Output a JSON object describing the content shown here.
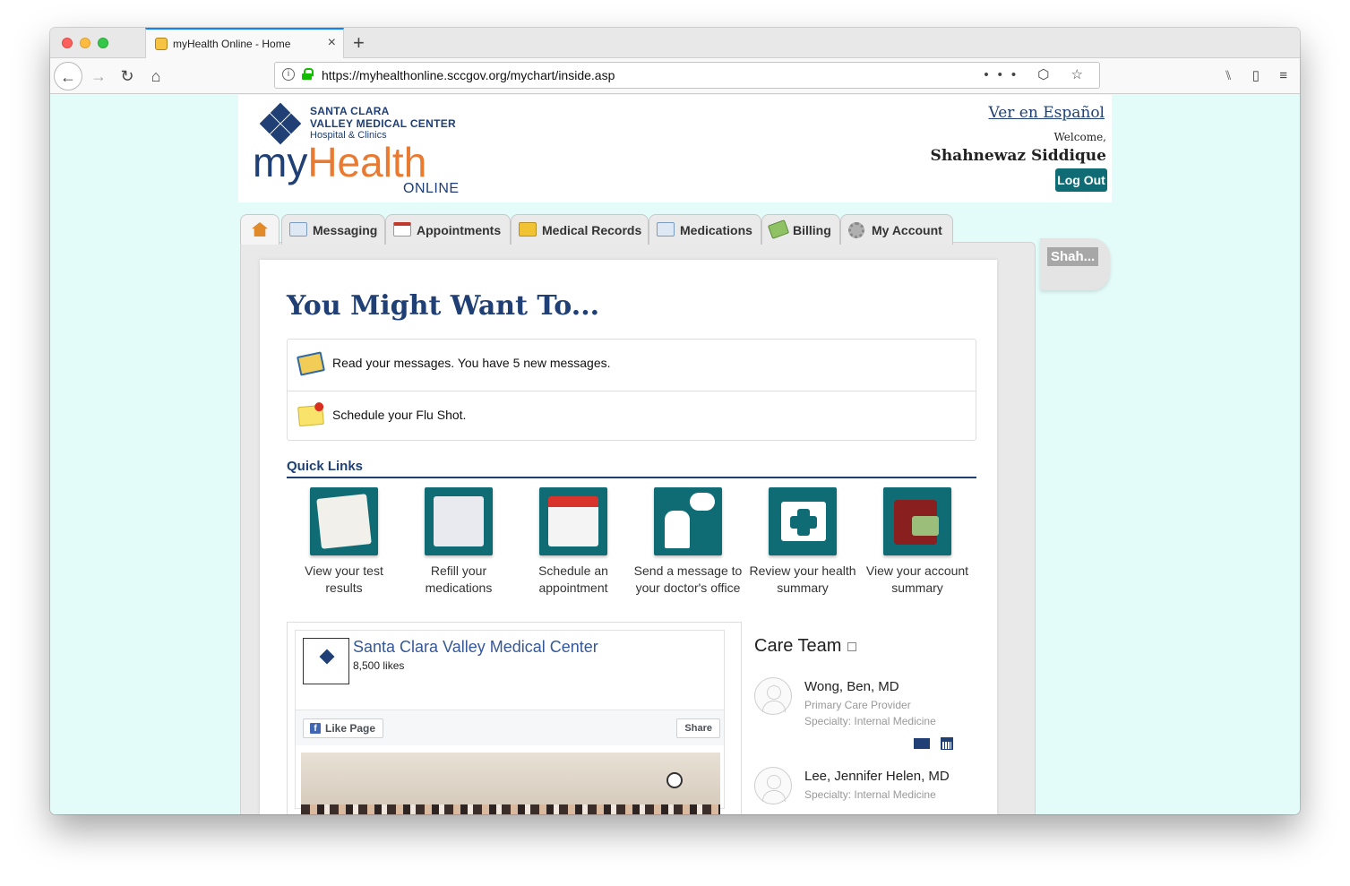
{
  "browser": {
    "tab_title": "myHealth Online - Home",
    "new_tab": "+",
    "close_tab": "×",
    "url_prefix": "https://",
    "url_host": "myhealthonline.sccgov.org",
    "url_path": "/mychart/inside.asp",
    "url_icons": "••• ⬡ ☆",
    "back": "←",
    "forward": "→",
    "reload": "↻",
    "home": "⌂",
    "library": "⑊",
    "sidebar": "▯",
    "menu": "≡"
  },
  "header": {
    "org_line1": "SANTA CLARA",
    "org_line2": "VALLEY MEDICAL CENTER",
    "org_line3": "Hospital & Clinics",
    "brand_my": "my",
    "brand_health": "Health",
    "brand_online": "ONLINE",
    "lang_link": "Ver en Español",
    "welcome": "Welcome,",
    "username": "Shahnewaz Siddique",
    "logout": "Log Out"
  },
  "tabs": [
    {
      "label": "",
      "icon": "home-icon"
    },
    {
      "label": "Messaging",
      "icon": "envelope-icon"
    },
    {
      "label": "Appointments",
      "icon": "calendar-icon"
    },
    {
      "label": "Medical Records",
      "icon": "folder-icon"
    },
    {
      "label": "Medications",
      "icon": "envelope-icon"
    },
    {
      "label": "Billing",
      "icon": "money-icon"
    },
    {
      "label": "My Account",
      "icon": "gear-icon"
    }
  ],
  "proxy_label": "Shah...",
  "main": {
    "title": "You Might Want To...",
    "messages": [
      {
        "text": "Read your messages. You have 5 new messages.",
        "icon": "envelope-icon"
      },
      {
        "text": "Schedule your Flu Shot.",
        "icon": "sticky-note-icon"
      }
    ],
    "quick_links_title": "Quick Links",
    "quick_links": [
      {
        "line1": "View your test",
        "line2": "results",
        "icon": "test-results-icon",
        "color": "#f2f0ea"
      },
      {
        "line1": "Refill your",
        "line2": "medications",
        "icon": "prescription-icon",
        "color": "#e9eaf0"
      },
      {
        "line1": "Schedule an",
        "line2": "appointment",
        "icon": "calendar-icon",
        "color": "#f4f4f4"
      },
      {
        "line1": "Send a message to",
        "line2": "your doctor's office",
        "icon": "doctor-message-icon",
        "color": "#0f6c74"
      },
      {
        "line1": "Review your health",
        "line2": "summary",
        "icon": "health-folder-icon",
        "color": "#0f6c74"
      },
      {
        "line1": "View your account",
        "line2": "summary",
        "icon": "wallet-icon",
        "color": "#8a1f1f"
      }
    ]
  },
  "facebook": {
    "page_name": "Santa Clara Valley Medical Center",
    "likes": "8,500 likes",
    "like_button": "Like Page",
    "share_button": "Share"
  },
  "care_team": {
    "title": "Care Team",
    "members": [
      {
        "name": "Wong, Ben, MD",
        "role": "Primary Care Provider",
        "specialty": "Specialty: Internal Medicine"
      },
      {
        "name": "Lee, Jennifer Helen, MD",
        "role": "",
        "specialty": "Specialty: Internal Medicine"
      }
    ]
  }
}
